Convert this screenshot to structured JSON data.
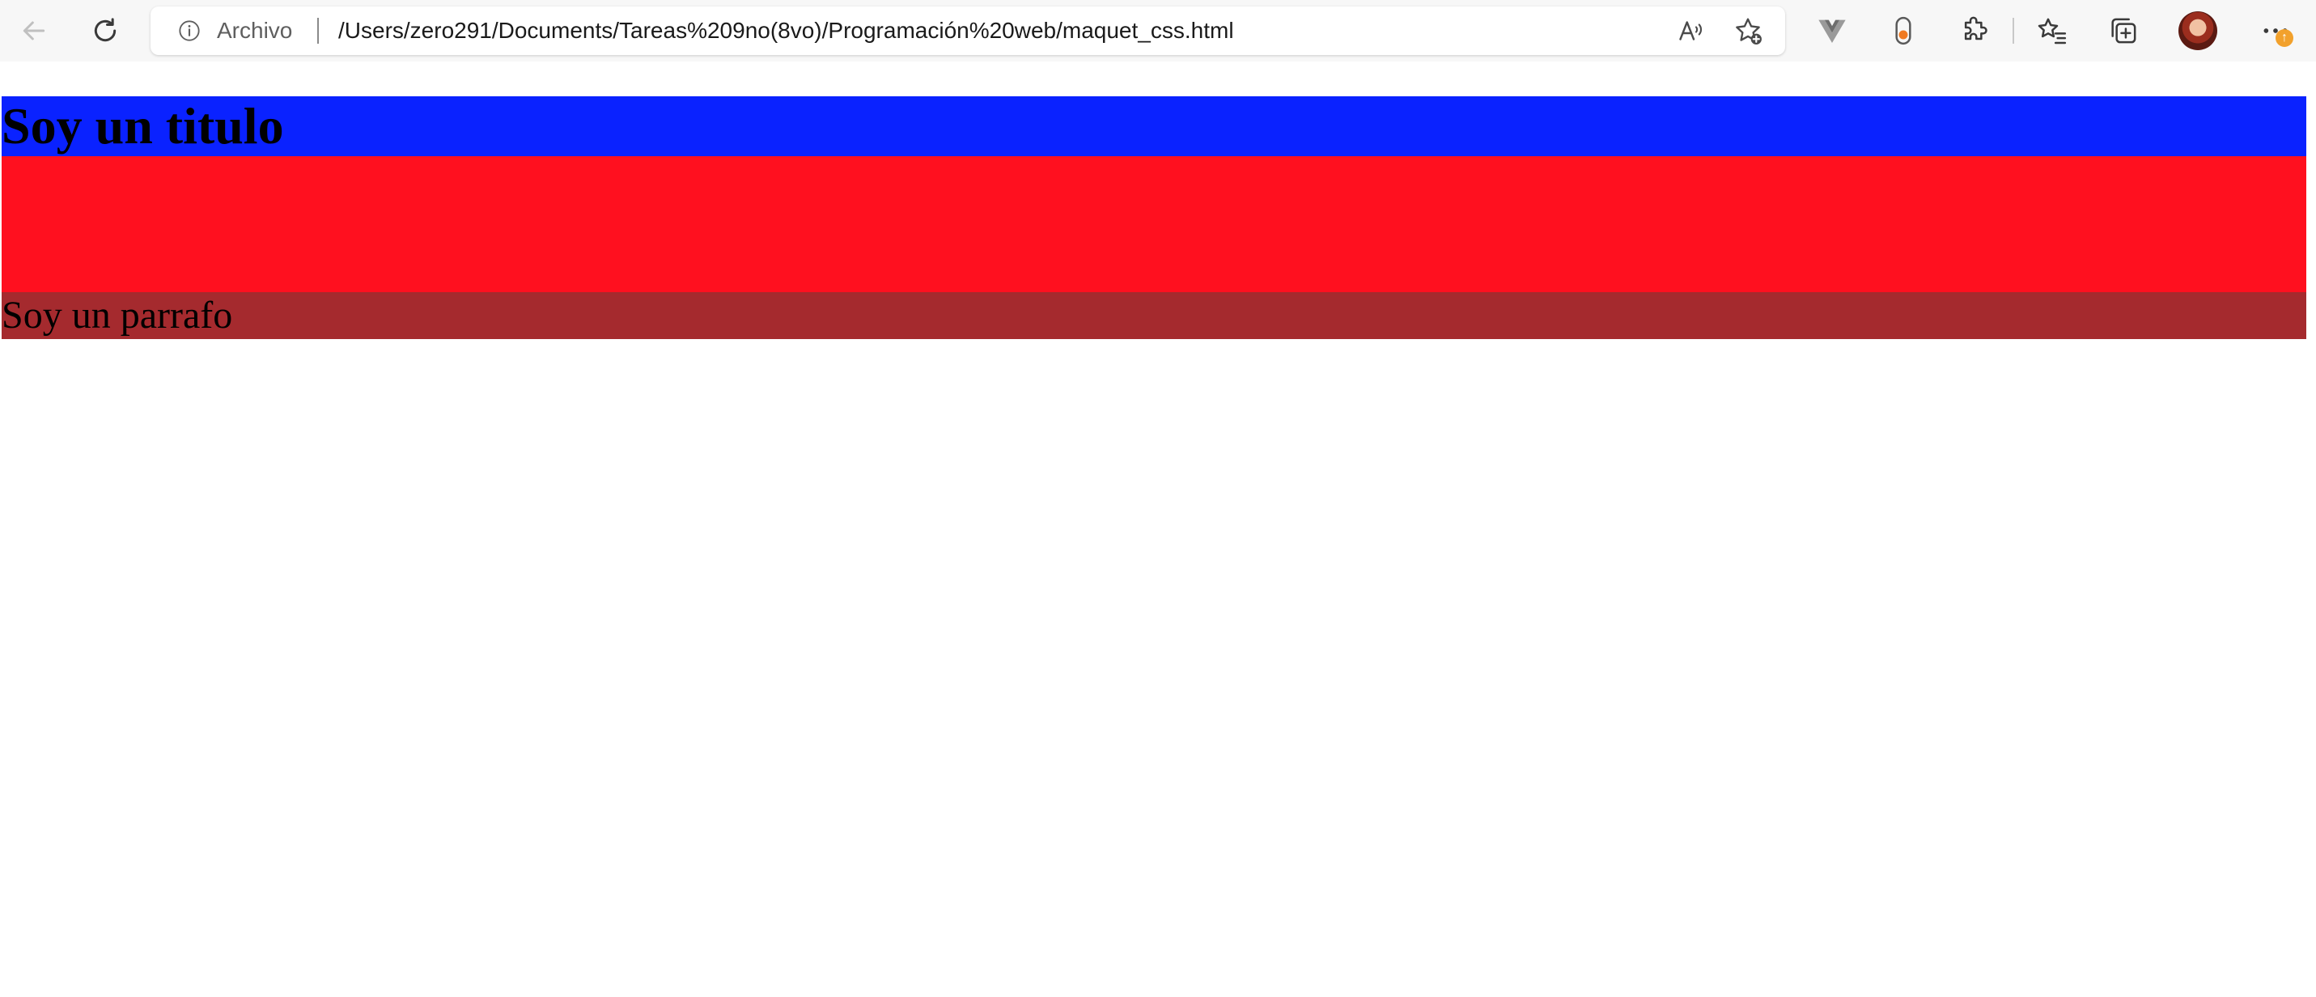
{
  "browser": {
    "site_label": "Archivo",
    "url": "/Users/zero291/Documents/Tareas%209no(8vo)/Programación%20web/maquet_css.html",
    "toolbar_icons": [
      "back-arrow-icon",
      "refresh-icon",
      "info-icon",
      "read-aloud-icon",
      "add-favorite-icon",
      "vue-devtools-icon",
      "extension-icon",
      "puzzle-extensions-icon",
      "favorites-icon",
      "collections-icon",
      "avatar",
      "more-menu-icon"
    ],
    "update_badge": "↑"
  },
  "page": {
    "title": "Soy un titulo",
    "paragraph": "Soy un parrafo"
  },
  "colors": {
    "title_background": "#0a22ff",
    "middle_background": "#ff101f",
    "paragraph_background": "#a52a2e",
    "text": "#000000"
  }
}
